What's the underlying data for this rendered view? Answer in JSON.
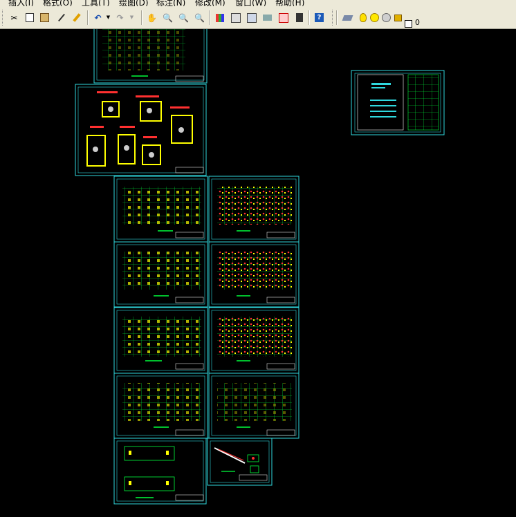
{
  "menu": [
    "插入(I)",
    "格式(O)",
    "工具(T)",
    "绘图(D)",
    "标注(N)",
    "修改(M)",
    "窗口(W)",
    "帮助(H)"
  ],
  "toolbar": {
    "icons": [
      "cut-icon",
      "copy-icon",
      "paste-icon",
      "match-properties-icon",
      "brush-icon",
      "undo-icon",
      "undo-dropdown-icon",
      "redo-icon",
      "redo-dropdown-icon",
      "pan-icon",
      "zoom-realtime-icon",
      "zoom-window-icon",
      "zoom-previous-icon",
      "properties-icon",
      "design-center-icon",
      "tool-palettes-icon",
      "sheet-set-icon",
      "markup-icon",
      "calculator-icon",
      "help-icon",
      "layer-manager-icon",
      "layer-on-icon",
      "layer-freeze-icon",
      "layer-lock-icon"
    ],
    "layer_name": "0"
  },
  "colors": {
    "sheet_border": "#2fd8de",
    "grid": "#00ff3c",
    "highlight": "#ffff00",
    "accent_red": "#ff3030",
    "title_text": "#ffffff"
  }
}
